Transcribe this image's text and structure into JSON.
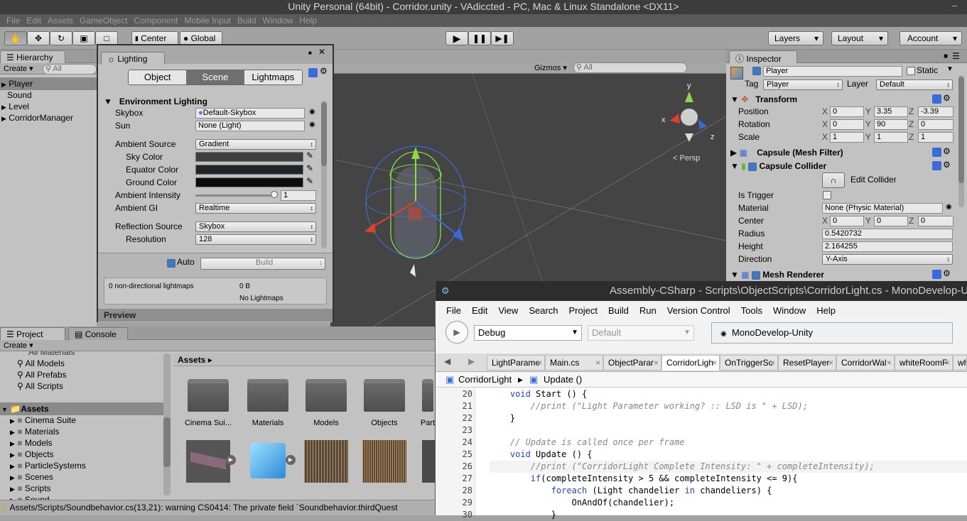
{
  "window": {
    "title": "Unity Personal (64bit) - Corridor.unity - VAdiccted - PC, Mac & Linux Standalone <DX11>",
    "minimize": "–"
  },
  "menu": [
    "File",
    "Edit",
    "Assets",
    "GameObject",
    "Component",
    "Mobile Input",
    "Build",
    "Window",
    "Help"
  ],
  "toolbar": {
    "center": "Center",
    "global": "Global",
    "layers": "Layers",
    "layout": "Layout",
    "account": "Account"
  },
  "hierarchy": {
    "tab": "Hierarchy",
    "create": "Create",
    "search": "All",
    "items": [
      "Player",
      "Sound",
      "Level",
      "CorridorManager"
    ]
  },
  "lighting": {
    "tab": "Lighting",
    "tabs": [
      "Object",
      "Scene",
      "Lightmaps"
    ],
    "section": "Environment Lighting",
    "skybox_label": "Skybox",
    "skybox": "Default-Skybox",
    "sun_label": "Sun",
    "sun": "None (Light)",
    "ambient_source_label": "Ambient Source",
    "ambient_source": "Gradient",
    "sky_color": "Sky Color",
    "equator_color": "Equator Color",
    "ground_color": "Ground Color",
    "ambient_intensity_label": "Ambient Intensity",
    "ambient_intensity": "1",
    "ambient_gi_label": "Ambient GI",
    "ambient_gi": "Realtime",
    "reflection_source_label": "Reflection Source",
    "reflection_source": "Skybox",
    "resolution_label": "Resolution",
    "resolution": "128",
    "auto": "Auto",
    "build": "Build",
    "lightmaps_count": "0 non-directional lightmaps",
    "size": "0 B",
    "no_lightmaps": "No Lightmaps",
    "preview": "Preview"
  },
  "scene": {
    "gizmos": "Gizmos",
    "search": "All",
    "persp": "Persp",
    "axes": {
      "y": "y",
      "x": "x",
      "z": "z"
    }
  },
  "inspector": {
    "tab": "Inspector",
    "name": "Player",
    "static": "Static",
    "tag_label": "Tag",
    "tag": "Player",
    "layer_label": "Layer",
    "layer": "Default",
    "transform": "Transform",
    "position": {
      "label": "Position",
      "x": "0",
      "y": "3.35",
      "z": "-3.39"
    },
    "rotation": {
      "label": "Rotation",
      "x": "0",
      "y": "90",
      "z": "0"
    },
    "scale": {
      "label": "Scale",
      "x": "1",
      "y": "1",
      "z": "1"
    },
    "mesh_filter": "Capsule (Mesh Filter)",
    "capsule_collider": "Capsule Collider",
    "edit_collider": "Edit Collider",
    "is_trigger": "Is Trigger",
    "material_label": "Material",
    "material": "None (Physic Material)",
    "center": {
      "label": "Center",
      "x": "0",
      "y": "0",
      "z": "0"
    },
    "radius_label": "Radius",
    "radius": "0.5420732",
    "height_label": "Height",
    "height": "2.164255",
    "direction_label": "Direction",
    "direction": "Y-Axis",
    "mesh_renderer": "Mesh Renderer"
  },
  "project": {
    "tab": "Project",
    "console_tab": "Console",
    "create": "Create",
    "partial": "All Materials",
    "favorites": [
      "All Models",
      "All Prefabs",
      "All Scripts"
    ],
    "assets_root": "Assets",
    "folders": [
      "Cinema Suite",
      "Materials",
      "Models",
      "Objects",
      "ParticleSystems",
      "Scenes",
      "Scripts",
      "Sound"
    ],
    "breadcrumb": "Assets",
    "grid": [
      "Cinema Sui...",
      "Materials",
      "Models",
      "Objects",
      "Part"
    ]
  },
  "status": "Assets/Scripts/Soundbehavior.cs(13,21): warning CS0414: The private field `Soundbehavior.thirdQuest",
  "monodevelop": {
    "title": "Assembly-CSharp - Scripts\\ObjectScripts\\CorridorLight.cs - MonoDevelop-U",
    "menu": [
      "File",
      "Edit",
      "View",
      "Search",
      "Project",
      "Build",
      "Run",
      "Version Control",
      "Tools",
      "Window",
      "Help"
    ],
    "config": "Debug",
    "platform": "Default",
    "status": "MonoDevelop-Unity",
    "tabs": [
      "LightParame",
      "Main.cs",
      "ObjectParar",
      "CorridorLigh",
      "OnTriggerSc",
      "ResetPlayer",
      "CorridorWal",
      "whiteRoomF",
      "wh"
    ],
    "breadcrumb_class": "CorridorLight",
    "breadcrumb_method": "Update ()",
    "lines": [
      {
        "n": "20",
        "t": "    void Start () {"
      },
      {
        "n": "21",
        "t": "        //print (\"Light Parameter working? :: LSD is \" + LSD);"
      },
      {
        "n": "22",
        "t": "    }"
      },
      {
        "n": "23",
        "t": ""
      },
      {
        "n": "24",
        "t": "    // Update is called once per frame"
      },
      {
        "n": "25",
        "t": "    void Update () {"
      },
      {
        "n": "26",
        "t": "        //print (\"CorridorLight Complete Intensity: \" + completeIntensity);"
      },
      {
        "n": "27",
        "t": "        if(completeIntensity > 5 && completeIntensity <= 9){"
      },
      {
        "n": "28",
        "t": "            foreach (Light chandelier in chandeliers) {"
      },
      {
        "n": "29",
        "t": "                OnAndOf(chandelier);"
      },
      {
        "n": "30",
        "t": "            }"
      }
    ]
  }
}
